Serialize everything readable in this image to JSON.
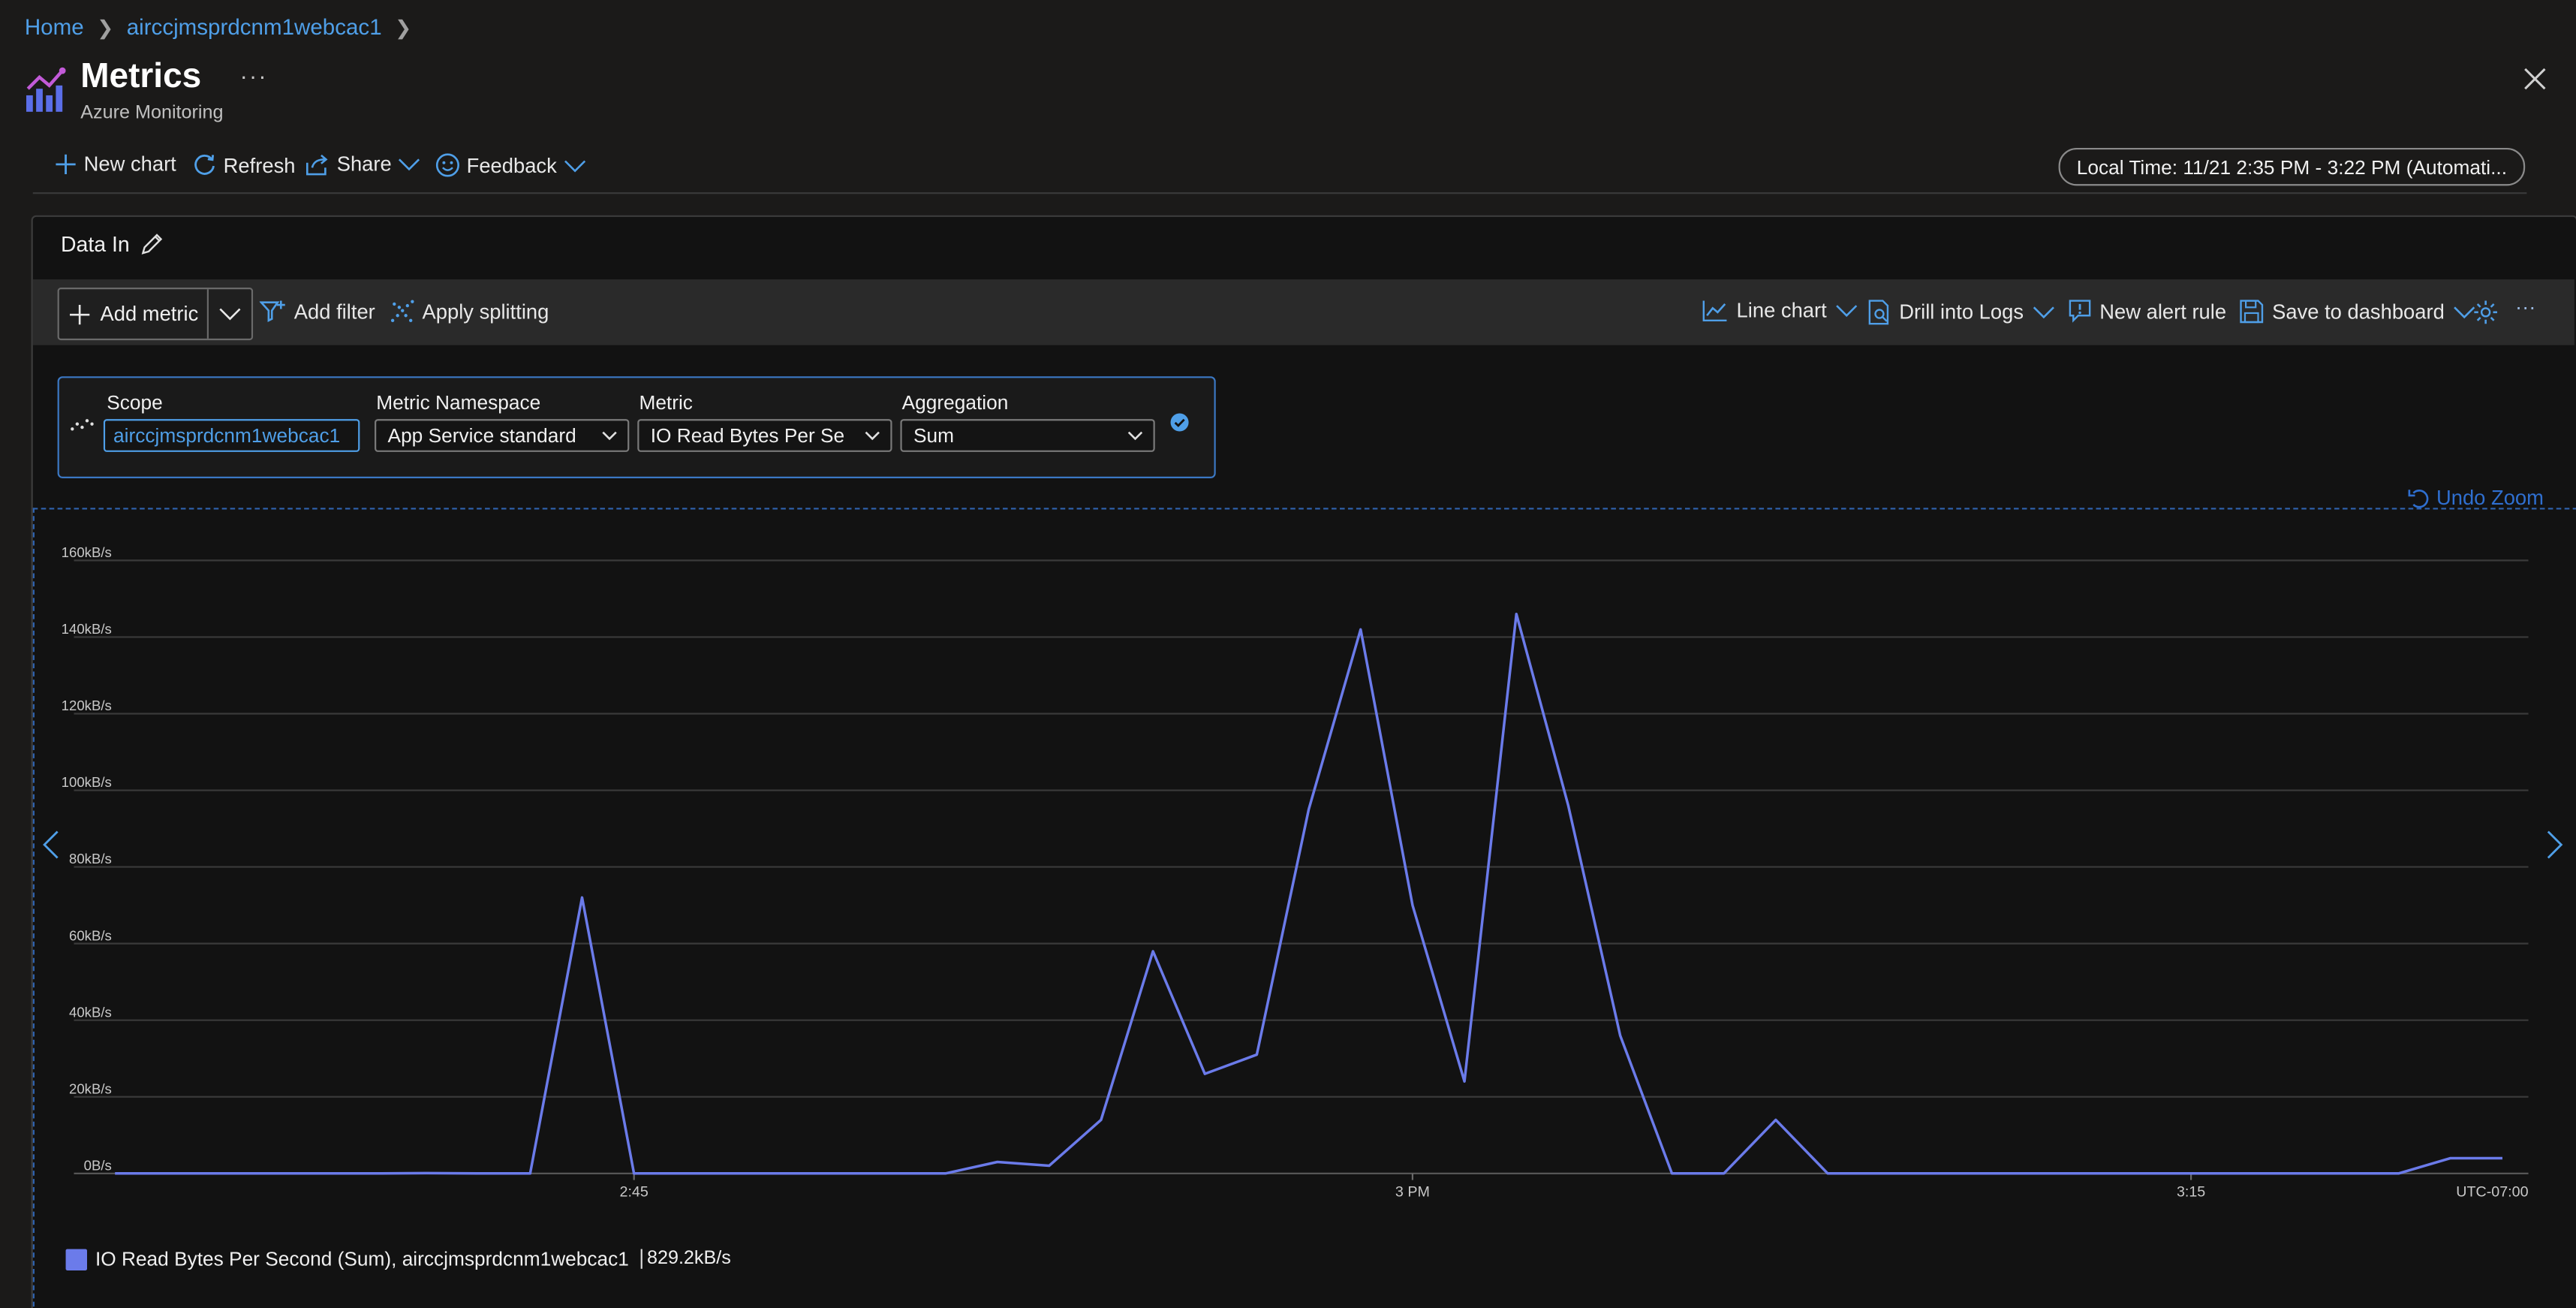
{
  "breadcrumb": {
    "home": "Home",
    "resource": "airccjmsprdcnm1webcac1"
  },
  "header": {
    "title": "Metrics",
    "subtitle": "Azure Monitoring",
    "more": "···"
  },
  "toolbar": {
    "new_chart": "New chart",
    "refresh": "Refresh",
    "share": "Share",
    "feedback": "Feedback",
    "time_range": "Local Time: 11/21 2:35 PM - 3:22 PM (Automati..."
  },
  "panel": {
    "title": "Data In"
  },
  "chart_toolbar": {
    "add_metric": "Add metric",
    "add_filter": "Add filter",
    "apply_splitting": "Apply splitting",
    "line_chart": "Line chart",
    "drill_logs": "Drill into Logs",
    "new_alert": "New alert rule",
    "save_dashboard": "Save to dashboard",
    "more": "···"
  },
  "metric_row": {
    "scope_label": "Scope",
    "scope_value": "airccjmsprdcnm1webcac1",
    "namespace_label": "Metric Namespace",
    "namespace_value": "App Service standard",
    "metric_label": "Metric",
    "metric_value": "IO Read Bytes Per Se",
    "aggregation_label": "Aggregation",
    "aggregation_value": "Sum"
  },
  "undo_zoom": "Undo Zoom",
  "colors": {
    "accent": "#4f9fe8",
    "series": "#6b7bea",
    "background": "#121212"
  },
  "chart_data": {
    "type": "line",
    "y_unit": "kB/s",
    "ylim": [
      0,
      160
    ],
    "y_ticks": [
      "0B/s",
      "20kB/s",
      "40kB/s",
      "60kB/s",
      "80kB/s",
      "100kB/s",
      "120kB/s",
      "140kB/s",
      "160kB/s"
    ],
    "x_tick_labels": [
      "2:45",
      "3 PM",
      "3:15"
    ],
    "x_tick_minutes": [
      10,
      25,
      40
    ],
    "timezone_label": "UTC-07:00",
    "grid": true,
    "series": [
      {
        "name": "IO Read Bytes Per Second (Sum), airccjmsprdcnm1webcac1",
        "legend_value": "829.2kB/s",
        "color": "#6b7bea",
        "x_minutes": [
          0,
          1,
          2,
          3,
          4,
          5,
          6,
          7,
          8,
          9,
          10,
          11,
          12,
          13,
          14,
          15,
          16,
          17,
          18,
          19,
          20,
          21,
          22,
          23,
          24,
          25,
          26,
          27,
          28,
          29,
          30,
          31,
          32,
          33,
          34,
          35,
          36,
          37,
          38,
          39,
          40,
          41,
          42,
          43,
          44,
          45,
          46
        ],
        "values": [
          0,
          0,
          0,
          0,
          0,
          0,
          0.1,
          0,
          0,
          72,
          0,
          0,
          0,
          0,
          0,
          0,
          0,
          3,
          2,
          14,
          58,
          26,
          31,
          95,
          142,
          70,
          24,
          146,
          96,
          36,
          0,
          0,
          14,
          0,
          0,
          0,
          0,
          0,
          0,
          0,
          0,
          0,
          0,
          0,
          0,
          4,
          4
        ]
      }
    ]
  }
}
